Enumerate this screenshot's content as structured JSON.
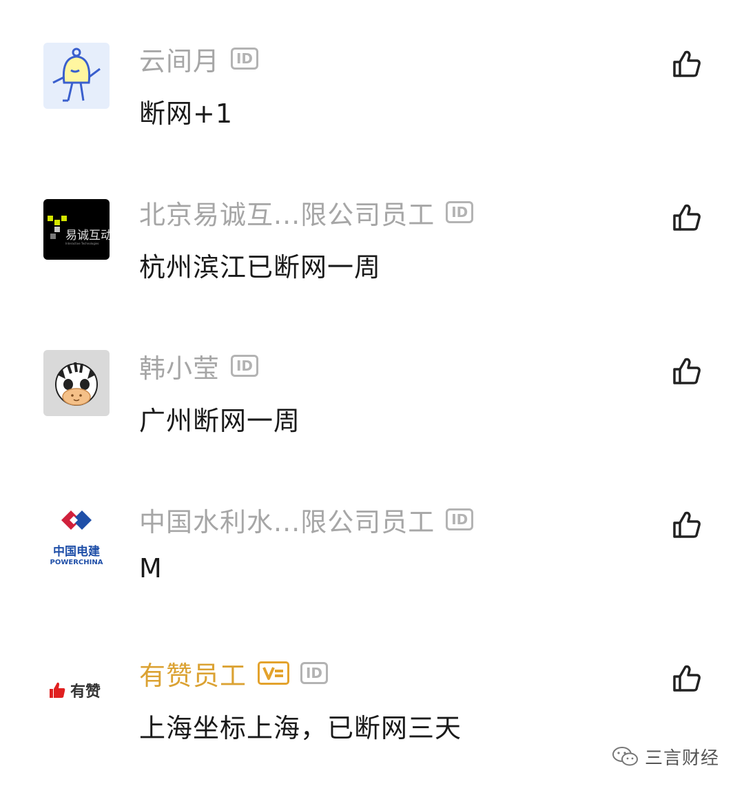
{
  "comments": [
    {
      "user": "云间月",
      "text": "断网+1",
      "id_label": "ID"
    },
    {
      "user": "北京易诚互...限公司员工",
      "text": "杭州滨江已断网一周",
      "id_label": "ID",
      "avatar_text": "易诚互动",
      "avatar_subtext": "Interactive Technologies"
    },
    {
      "user": "韩小莹",
      "text": "广州断网一周",
      "id_label": "ID"
    },
    {
      "user": "中国水利水...限公司员工",
      "text": "M",
      "id_label": "ID",
      "avatar_text": "中国电建",
      "avatar_subtext": "POWERCHINA"
    },
    {
      "user": "有赞员工",
      "text": "上海坐标上海，已断网三天",
      "id_label": "ID",
      "avatar_text": "有赞"
    }
  ],
  "watermark": {
    "text": "三言财经"
  },
  "colors": {
    "name_gray": "#a6a6a6",
    "verified_gold": "#dba233",
    "text": "#1a1a1a"
  }
}
